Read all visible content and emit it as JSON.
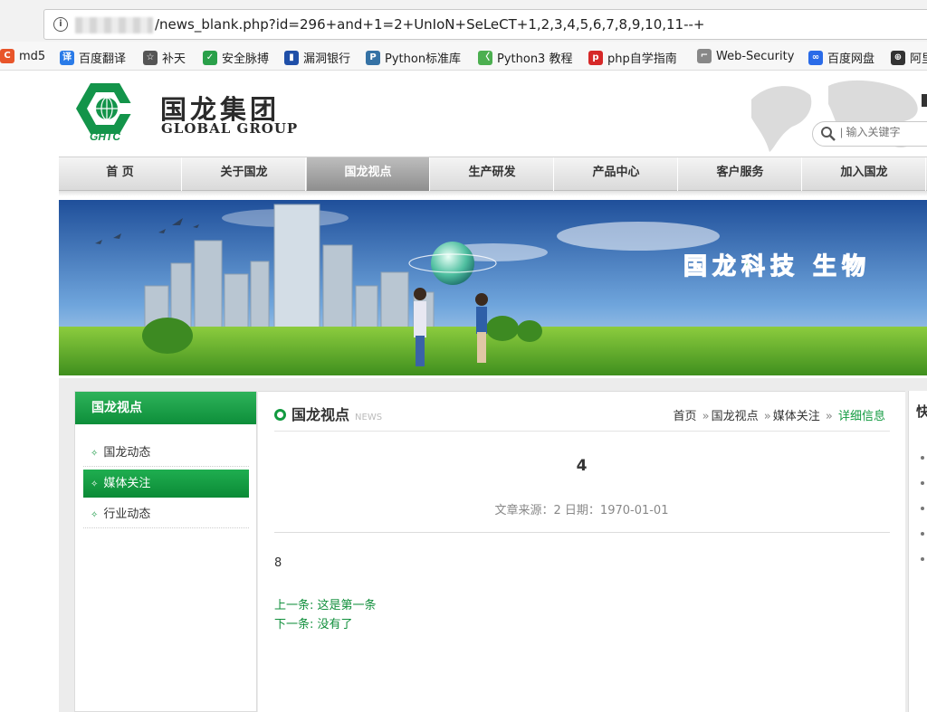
{
  "browser": {
    "url": "/news_blank.php?id=296+and+1=2+UnIoN+SeLeCT+1,2,3,4,5,6,7,8,9,10,11--+",
    "bookmarks": [
      {
        "label": "md5",
        "icon": "md5-icon",
        "color": "#e8552a"
      },
      {
        "label": "百度翻译",
        "icon": "translate-icon",
        "color": "#2a7be8"
      },
      {
        "label": "补天",
        "icon": "butian-icon",
        "color": "#555555"
      },
      {
        "label": "安全脉搏",
        "icon": "shield-icon",
        "color": "#2aa04a"
      },
      {
        "label": "漏洞银行",
        "icon": "bookmark-flag-icon",
        "color": "#1f4fa8"
      },
      {
        "label": "Python标准库",
        "icon": "python-icon",
        "color": "#3572a5"
      },
      {
        "label": "Python3 教程",
        "icon": "code-icon",
        "color": "#4caf50"
      },
      {
        "label": "php自学指南",
        "icon": "php-icon",
        "color": "#d62828"
      },
      {
        "label": "Web-Security",
        "icon": "web-security-icon",
        "color": "#888888"
      },
      {
        "label": "百度网盘",
        "icon": "cloud-icon",
        "color": "#2a6be8"
      },
      {
        "label": "阿里",
        "icon": "globe-icon",
        "color": "#333333"
      }
    ]
  },
  "header": {
    "logo_mark_text": "GHTC",
    "logo_cn": "国龙集团",
    "logo_en": "GLOBAL GROUP",
    "search_placeholder": "| 输入关键字"
  },
  "nav": {
    "items": [
      "首 页",
      "关于国龙",
      "国龙视点",
      "生产研发",
      "产品中心",
      "客户服务",
      "加入国龙"
    ],
    "active_index": 2
  },
  "banner": {
    "slogan": "国龙科技  生物"
  },
  "sidebar": {
    "title": "国龙视点",
    "items": [
      "国龙动态",
      "媒体关注",
      "行业动态"
    ],
    "active_index": 1
  },
  "main": {
    "title": "国龙视点",
    "subtitle": "NEWS",
    "breadcrumb": {
      "home": "首页",
      "section": "国龙视点",
      "category": "媒体关注",
      "current": "详细信息"
    },
    "article": {
      "title": "4",
      "meta": "文章来源：2 日期：1970-01-01",
      "body": "8",
      "prev": "上一条: 这是第一条",
      "next": "下一条: 没有了"
    }
  },
  "right_panel": {
    "title_fragment": "快"
  },
  "colors": {
    "accent_green": "#129a40",
    "nav_active": "#9e9e9e"
  }
}
